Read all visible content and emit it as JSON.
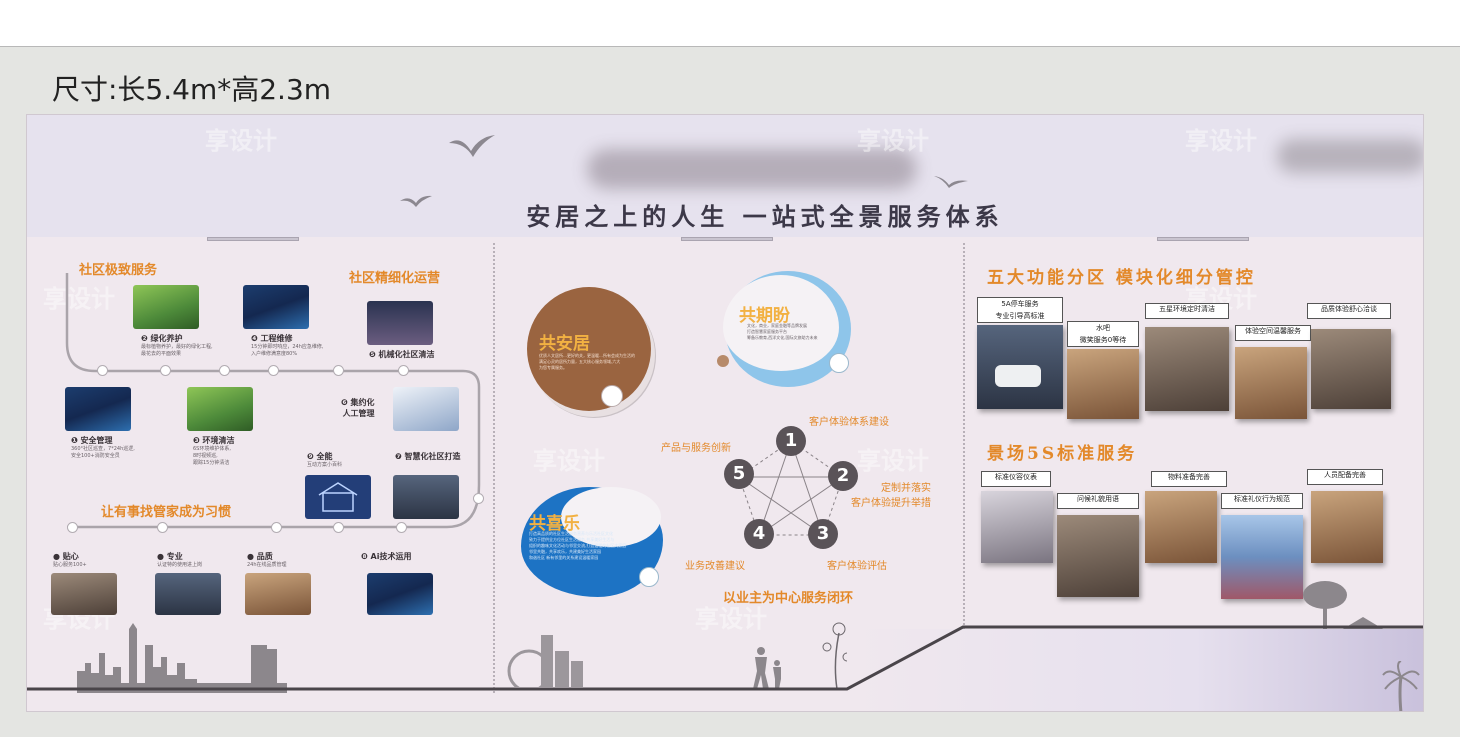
{
  "size_label": "尺寸:长5.4m*高2.3m",
  "header": {
    "tagline": "安居之上的人生 一站式全景服务体系",
    "watermark": "享设计"
  },
  "left": {
    "title_service": "社区极致服务",
    "title_ops": "社区精细化运营",
    "title_habit": "让有事找管家成为习惯",
    "items": [
      {
        "label": "❷ 绿化养护",
        "desc": "最标植物养护，最好的绿化工程,\n最花去的平面效果"
      },
      {
        "label": "❹ 工程维修",
        "desc": "15分钟即时响应，24h应急维修,\n入户维修满意度80%"
      },
      {
        "label": "❺ 机械化社区清洁",
        "desc": ""
      },
      {
        "label": "❶ 安全管理",
        "desc": "360°社区巡查，7*24h巡逻,\n安全100+消防安全员"
      },
      {
        "label": "❸ 环境清洁",
        "desc": "6S环境维护体系,\n8时视频巡,\n跟踪15分钟清洁"
      },
      {
        "label": "❻ 集约化\n人工管理",
        "desc": ""
      },
      {
        "label": "❾ 全能",
        "desc": "互动方案小百科"
      },
      {
        "label": "❼ 智慧化社区打造",
        "desc": ""
      },
      {
        "label": "● 贴心",
        "desc": "贴心服务100+"
      },
      {
        "label": "● 专业",
        "desc": "认证特的使用进上岗"
      },
      {
        "label": "● 品质",
        "desc": "24h在线品质管理"
      },
      {
        "label": "❽ Ai技术运用",
        "desc": ""
      }
    ]
  },
  "middle": {
    "circles": [
      {
        "title": "共安居",
        "text": "优质人文居所…更好的关，更温暖…所有会成为生活的\n满足心灵的居所力量，五大核心服务领域,六大\n为您专属服务。"
      },
      {
        "title": "共期盼",
        "text": "文化，商业，家庭金融等品牌发展\n打造智慧家庭服务平台\n筹备乐教育,西洋文化,国际文旅助力未来"
      },
      {
        "title": "共喜乐",
        "text": "打造高品质的社区生活服务营养与乐活社区文化\n致力于提供全方位社区生活服务,共享美好生活与\n组织的趣味文化活动与邻里交流,打造温暖的社区大家庭\n邻里共融，共享欢乐，共建美好生活家园\n和谐社区 新有邻里的关系建设温暖家园"
      }
    ],
    "loop_nodes": [
      {
        "num": "1",
        "label": "客户体验体系建设"
      },
      {
        "num": "2",
        "label": "定制并落实\n客户体验提升举措"
      },
      {
        "num": "3",
        "label": "客户体验评估"
      },
      {
        "num": "4",
        "label": "业务改善建议"
      },
      {
        "num": "5",
        "label": "产品与服务创新"
      }
    ],
    "loop_title": "以业主为中心服务闭环"
  },
  "right": {
    "title_zones": "五大功能分区 模块化细分管控",
    "title_5s": "景场5S标准服务",
    "zones": [
      "5A停车服务\n专业引导高标准",
      "水吧\n微笑服务0等待",
      "五星环境定时清洁",
      "体验空间温馨服务",
      "品质体验舒心洽谈"
    ],
    "standards": [
      "标准仪容仪表",
      "问候礼貌用语",
      "物料准备完善",
      "标准礼仪行为规范",
      "人员配备完善"
    ]
  },
  "colors": {
    "accent": "#e3892a",
    "band": "#e6e2ee",
    "board": "#f0e8ee",
    "brown": "#9a6440",
    "sky": "#8ec5ea",
    "blue": "#1d73c4"
  }
}
